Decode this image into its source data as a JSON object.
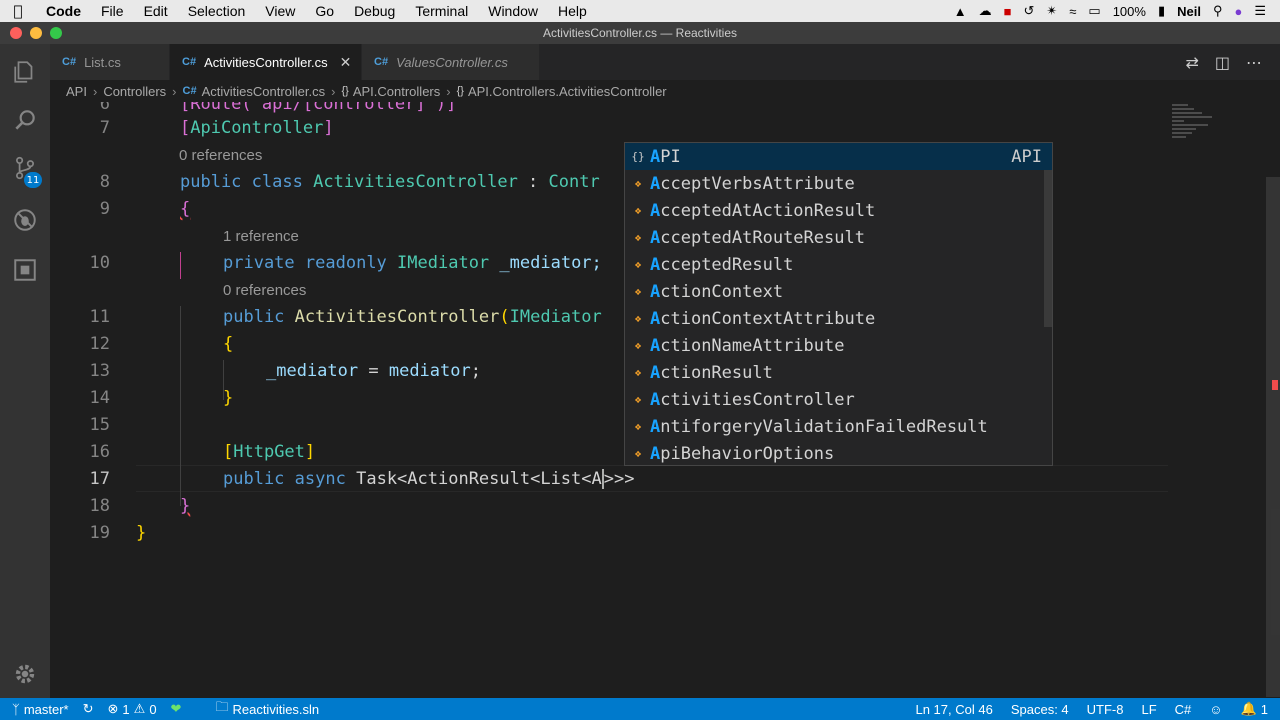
{
  "menubar": {
    "app": "Code",
    "items": [
      "File",
      "Edit",
      "Selection",
      "View",
      "Go",
      "Debug",
      "Terminal",
      "Window",
      "Help"
    ],
    "battery": "100%",
    "user": "Neil"
  },
  "window": {
    "title": "ActivitiesController.cs — Reactivities"
  },
  "activity_bar": {
    "scm_badge": "11"
  },
  "tabs": [
    {
      "label": "List.cs",
      "lang": "C#"
    },
    {
      "label": "ActivitiesController.cs",
      "lang": "C#"
    },
    {
      "label": "ValuesController.cs",
      "lang": "C#"
    }
  ],
  "breadcrumb": {
    "items": [
      "API",
      "Controllers",
      "ActivitiesController.cs",
      "API.Controllers",
      "API.Controllers.ActivitiesController"
    ],
    "lang": "C#",
    "ns_icon": "{}"
  },
  "editor": {
    "line6_partial": "[Route(\"api/[controller]\")]",
    "lens_refs_0a": "0 references",
    "lens_refs_1": "1 reference",
    "lens_refs_0b": "0 references",
    "lines": {
      "n6": "6",
      "n7": "7",
      "n8": "8",
      "n9": "9",
      "n10": "10",
      "n11": "11",
      "n12": "12",
      "n13": "13",
      "n14": "14",
      "n15": "15",
      "n16": "16",
      "n17": "17",
      "n18": "18",
      "n19": "19"
    },
    "tokens": {
      "attr_api": "ApiController",
      "kw_public": "public",
      "kw_class": "class",
      "class_name": "ActivitiesController",
      "colon": " : ",
      "base_partial": "Contr",
      "kw_private": "private",
      "kw_readonly": "readonly",
      "imediator": "IMediator",
      "field": "_mediator;",
      "ctor_name": "ActivitiesController",
      "ctor_param": "IMediator",
      "assign_lhs": "_mediator",
      "assign_op": " = ",
      "assign_rhs": "mediator",
      "semicolon": ";",
      "attr_get": "HttpGet",
      "kw_async": "async",
      "ret_type": "Task<ActionResult<List<A",
      "ret_tail": ">>>"
    }
  },
  "suggest": {
    "items": [
      {
        "hl": "A",
        "rest": "PI",
        "detail": "API"
      },
      {
        "hl": "A",
        "rest": "cceptVerbsAttribute"
      },
      {
        "hl": "A",
        "rest": "cceptedAtActionResult"
      },
      {
        "hl": "A",
        "rest": "cceptedAtRouteResult"
      },
      {
        "hl": "A",
        "rest": "cceptedResult"
      },
      {
        "hl": "A",
        "rest": "ctionContext"
      },
      {
        "hl": "A",
        "rest": "ctionContextAttribute"
      },
      {
        "hl": "A",
        "rest": "ctionNameAttribute"
      },
      {
        "hl": "A",
        "rest": "ctionResult"
      },
      {
        "hl": "A",
        "rest": "ctivitiesController"
      },
      {
        "hl": "A",
        "rest": "ntiforgeryValidationFailedResult"
      },
      {
        "hl": "A",
        "rest": "piBehaviorOptions"
      }
    ],
    "ns_icon": "{}"
  },
  "statusbar": {
    "branch": "master*",
    "errors": "1",
    "warnings": "0",
    "solution": "Reactivities.sln",
    "position": "Ln 17, Col 46",
    "spaces": "Spaces: 4",
    "encoding": "UTF-8",
    "eol": "LF",
    "language": "C#",
    "notifications": "1"
  }
}
